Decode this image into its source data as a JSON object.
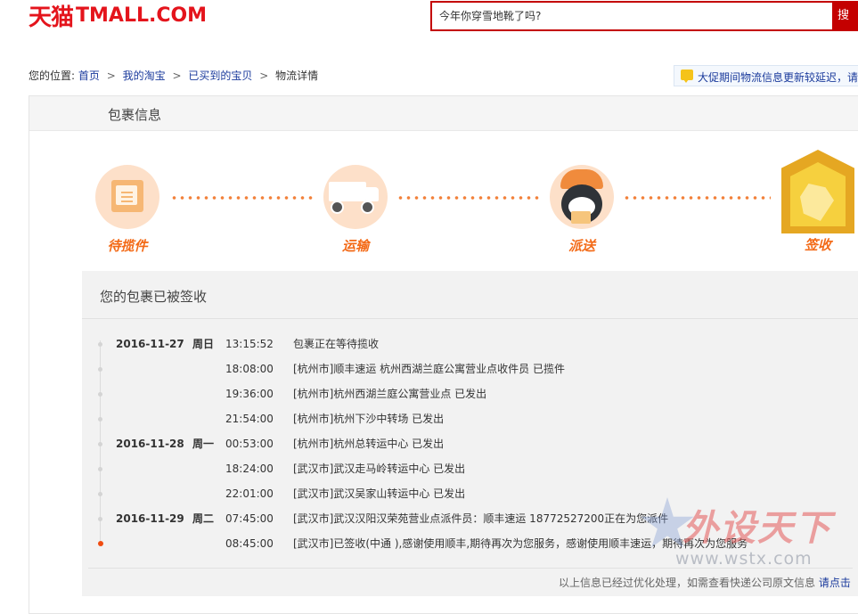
{
  "header": {
    "logo_cn": "天猫",
    "logo_en": "TMALL.COM",
    "search_placeholder": "今年你穿雪地靴了吗?",
    "search_button": "搜"
  },
  "breadcrumb": {
    "prefix": "您的位置:",
    "items": [
      "首页",
      "我的淘宝",
      "已买到的宝贝"
    ],
    "current": "物流详情",
    "sep": ">"
  },
  "notice": {
    "text": "大促期间物流信息更新较延迟，请"
  },
  "panel": {
    "title": "包裹信息"
  },
  "steps": [
    {
      "label": "待揽件",
      "icon": "package-icon"
    },
    {
      "label": "运输",
      "icon": "truck-icon"
    },
    {
      "label": "派送",
      "icon": "courier-icon"
    },
    {
      "label": "签收",
      "icon": "signed-badge-icon"
    }
  ],
  "status": {
    "title": "您的包裹已被签收"
  },
  "timeline": [
    {
      "date": "2016-11-27",
      "week": "周日",
      "time": "13:15:52",
      "desc": "包裹正在等待揽收"
    },
    {
      "date": "",
      "week": "",
      "time": "18:08:00",
      "desc": "[杭州市]顺丰速运 杭州西湖兰庭公寓营业点收件员 已揽件"
    },
    {
      "date": "",
      "week": "",
      "time": "19:36:00",
      "desc": "[杭州市]杭州西湖兰庭公寓营业点 已发出"
    },
    {
      "date": "",
      "week": "",
      "time": "21:54:00",
      "desc": "[杭州市]杭州下沙中转场 已发出"
    },
    {
      "date": "2016-11-28",
      "week": "周一",
      "time": "00:53:00",
      "desc": "[杭州市]杭州总转运中心 已发出"
    },
    {
      "date": "",
      "week": "",
      "time": "18:24:00",
      "desc": "[武汉市]武汉走马岭转运中心 已发出"
    },
    {
      "date": "",
      "week": "",
      "time": "22:01:00",
      "desc": "[武汉市]武汉吴家山转运中心 已发出"
    },
    {
      "date": "2016-11-29",
      "week": "周二",
      "time": "07:45:00",
      "desc": "[武汉市]武汉汉阳汉荣苑营业点派件员：顺丰速运 18772527200正在为您派件"
    },
    {
      "date": "",
      "week": "",
      "time": "08:45:00",
      "desc": "[武汉市]已签收(中通 ),感谢使用顺丰,期待再次为您服务，感谢使用顺丰速运，期待再次为您服务"
    }
  ],
  "footnote": {
    "text": "以上信息已经过优化处理，如需查看快递公司原文信息 ",
    "link": "请点击"
  },
  "watermark": {
    "text": "外设天下",
    "url": "www.wstx.com"
  },
  "colors": {
    "brand_red": "#c40000",
    "step_orange": "#f36a17",
    "link_blue": "#1a3a9c"
  }
}
